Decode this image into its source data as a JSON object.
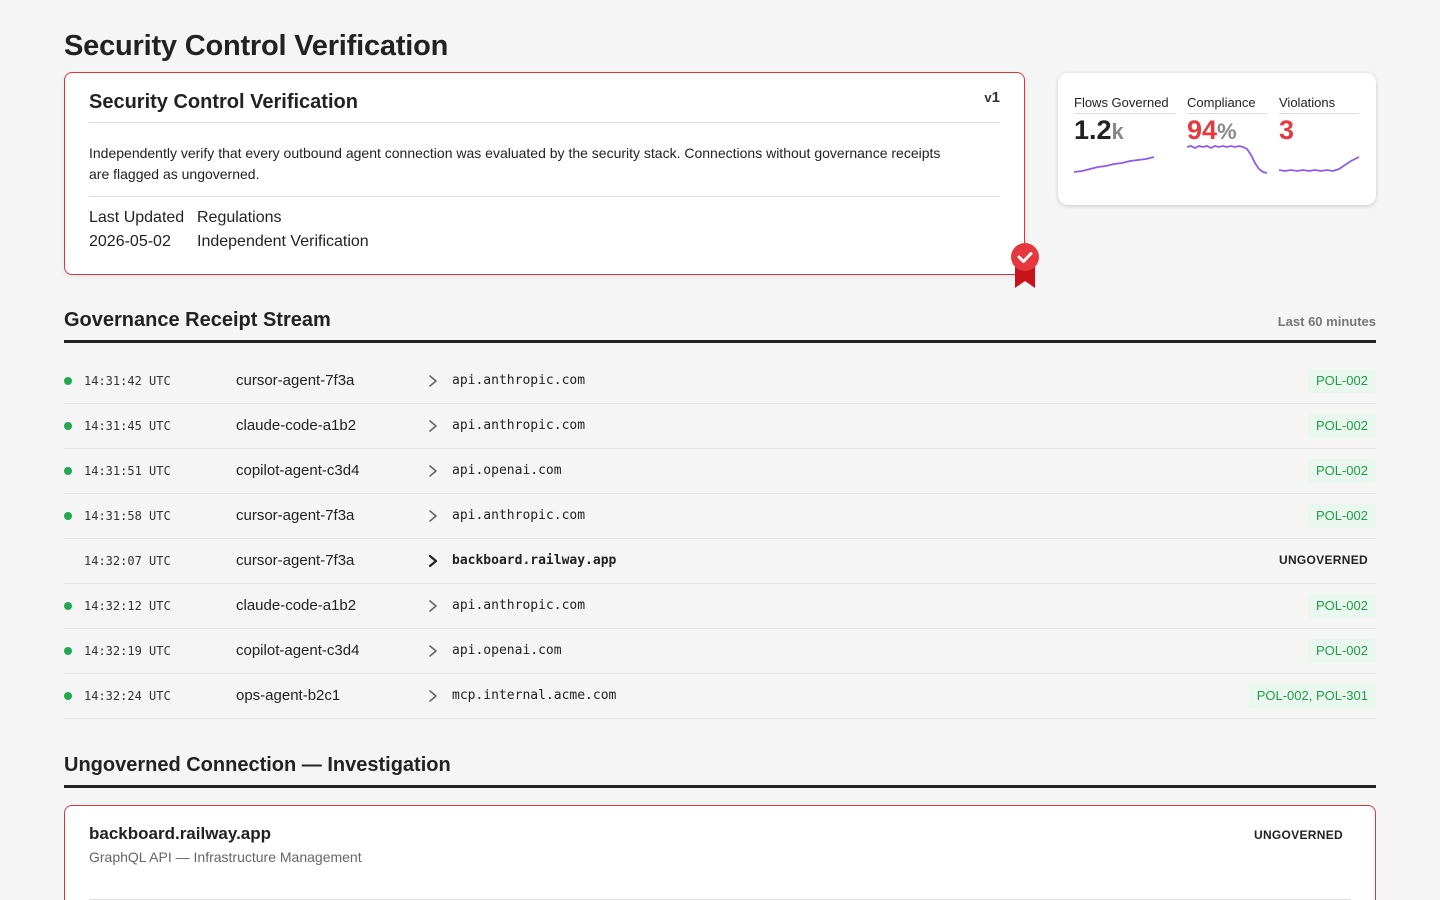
{
  "page": {
    "title": "Security Control Verification"
  },
  "card": {
    "title": "Security Control Verification",
    "version": "1",
    "version_prefix": "v",
    "description": "Independently verify that every outbound agent connection was evaluated by the security stack. Connections without governance receipts are flagged as ungoverned.",
    "meta": {
      "last_updated_label": "Last Updated",
      "last_updated_value": "2026-05-02",
      "regulations_label": "Regulations",
      "regulations_value": "Independent Verification"
    }
  },
  "metrics": {
    "flows": {
      "label": "Flows Governed",
      "value": "1.2",
      "unit": "k"
    },
    "compliance": {
      "label": "Compliance",
      "value": "94",
      "unit": "%"
    },
    "violations": {
      "label": "Violations",
      "value": "3"
    },
    "colors": {
      "accent_red": "#e5393f",
      "spark": "#8a5cf0"
    }
  },
  "stream": {
    "title": "Governance Receipt Stream",
    "range": "Last 60 minutes",
    "rows": [
      {
        "ts": "14:31:42 UTC",
        "agent": "cursor-agent-7f3a",
        "dest": "api.anthropic.com",
        "policy": "POL-002",
        "governed": true
      },
      {
        "ts": "14:31:45 UTC",
        "agent": "claude-code-a1b2",
        "dest": "api.anthropic.com",
        "policy": "POL-002",
        "governed": true
      },
      {
        "ts": "14:31:51 UTC",
        "agent": "copilot-agent-c3d4",
        "dest": "api.openai.com",
        "policy": "POL-002",
        "governed": true
      },
      {
        "ts": "14:31:58 UTC",
        "agent": "cursor-agent-7f3a",
        "dest": "api.anthropic.com",
        "policy": "POL-002",
        "governed": true
      },
      {
        "ts": "14:32:07 UTC",
        "agent": "cursor-agent-7f3a",
        "dest": "backboard.railway.app",
        "policy": "UNGOVERNED",
        "governed": false
      },
      {
        "ts": "14:32:12 UTC",
        "agent": "claude-code-a1b2",
        "dest": "api.anthropic.com",
        "policy": "POL-002",
        "governed": true
      },
      {
        "ts": "14:32:19 UTC",
        "agent": "copilot-agent-c3d4",
        "dest": "api.openai.com",
        "policy": "POL-002",
        "governed": true
      },
      {
        "ts": "14:32:24 UTC",
        "agent": "ops-agent-b2c1",
        "dest": "mcp.internal.acme.com",
        "policy": "POL-002, POL-301",
        "governed": true
      }
    ]
  },
  "investigation": {
    "title": "Ungoverned Connection — Investigation",
    "host": "backboard.railway.app",
    "subtitle": "GraphQL API — Infrastructure Management",
    "status": "UNGOVERNED"
  }
}
